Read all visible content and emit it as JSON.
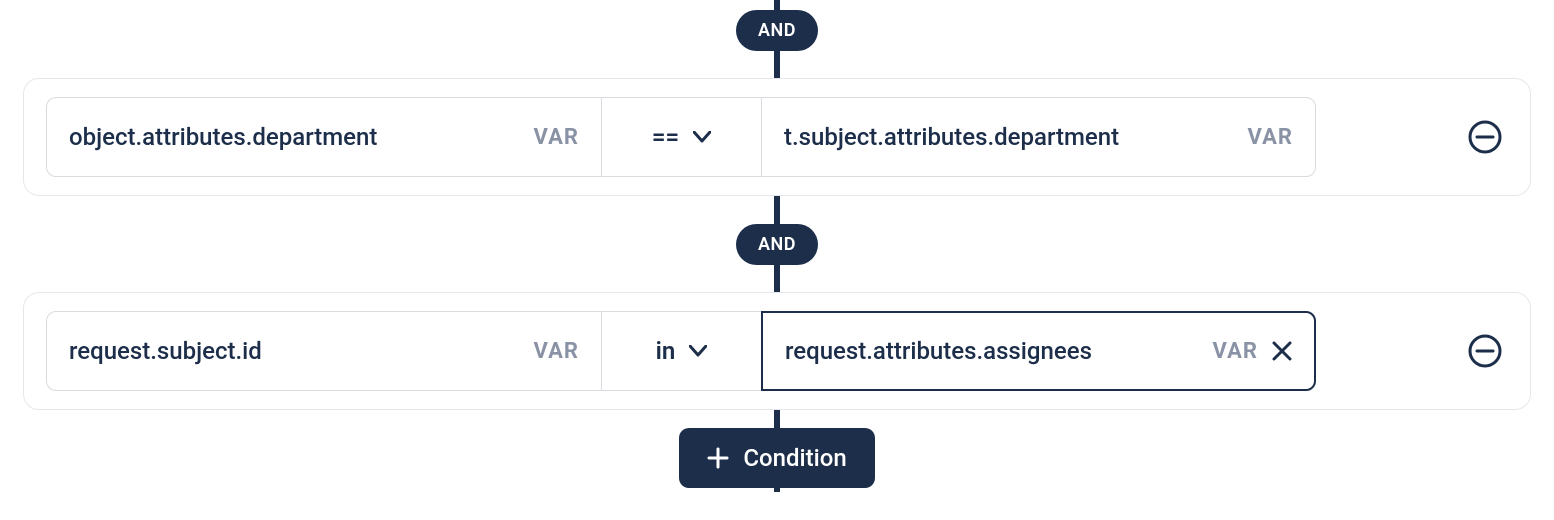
{
  "logic_label": "AND",
  "badge_label": "VAR",
  "add_button_label": "Condition",
  "conditions": [
    {
      "left": "object.attributes.department",
      "op": "==",
      "right": "t.subject.attributes.department",
      "right_focused": false,
      "right_clearable": false
    },
    {
      "left": "request.subject.id",
      "op": "in",
      "right": "request.attributes.assignees",
      "right_focused": true,
      "right_clearable": true
    }
  ]
}
